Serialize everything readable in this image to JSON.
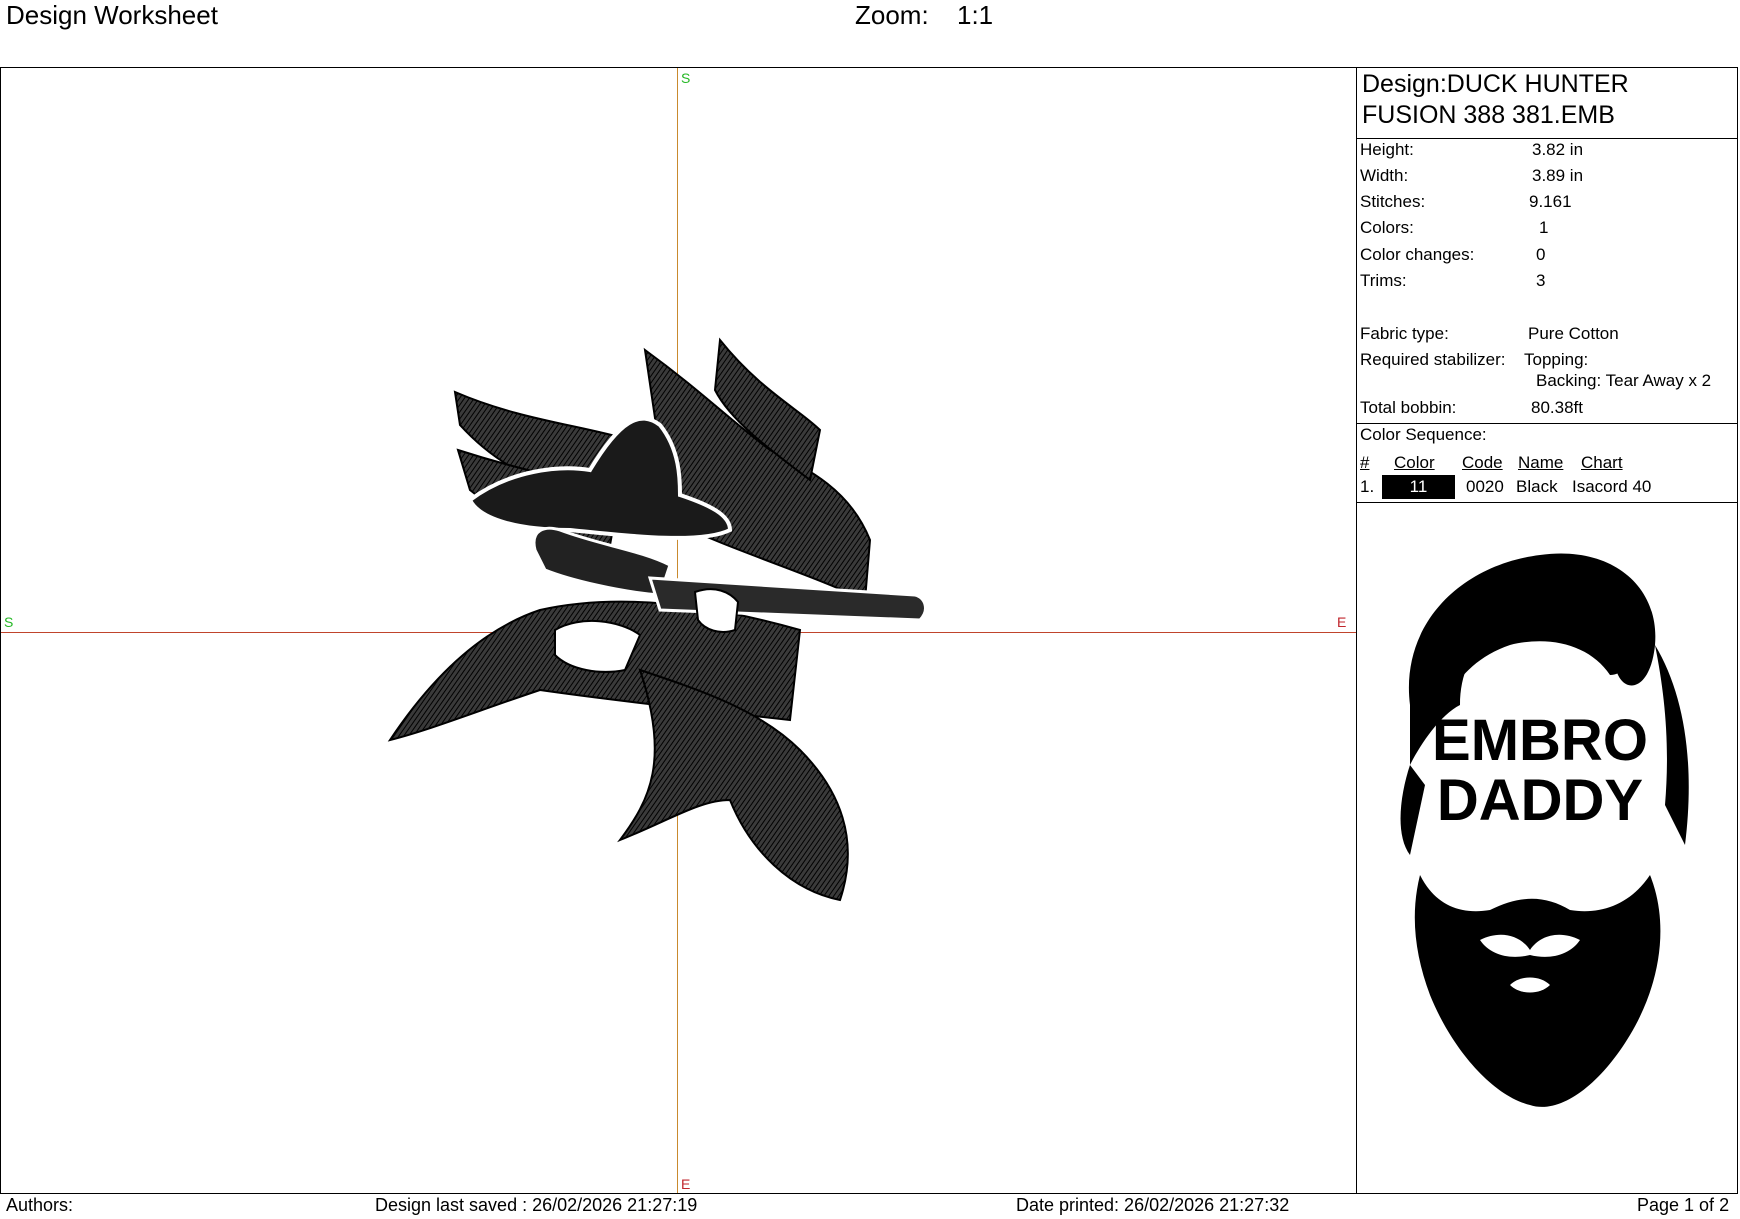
{
  "header": {
    "title": "Design Worksheet",
    "zoom_label": "Zoom:",
    "zoom_value": "1:1"
  },
  "axes": {
    "top": "S",
    "left": "S",
    "right": "E",
    "bottom": "E"
  },
  "colors": {
    "vertical_axis": "#c98a2e",
    "horizontal_axis": "#c0442c",
    "label_green": "#25b825",
    "label_red": "#c0262c",
    "thread": "#000000"
  },
  "panel": {
    "design_line1": "Design:DUCK HUNTER",
    "design_line2": "FUSION 388 381.EMB",
    "stats": [
      {
        "label": "Height:",
        "value": "3.82 in"
      },
      {
        "label": "Width:",
        "value": "3.89 in"
      },
      {
        "label": "Stitches:",
        "value": "9.161"
      },
      {
        "label": "Colors:",
        "value": "1"
      },
      {
        "label": "Color changes:",
        "value": "0"
      },
      {
        "label": "Trims:",
        "value": "3"
      }
    ],
    "fabric_label": "Fabric type:",
    "fabric_value": "Pure Cotton",
    "stabilizer_label": "Required stabilizer:",
    "stabilizer_topping": "Topping:",
    "stabilizer_backing": "Backing: Tear Away x 2",
    "bobbin_label": "Total bobbin:",
    "bobbin_value": "80.38ft",
    "sequence_title": "Color Sequence:",
    "sequence_headers": [
      "#",
      "Color",
      "Code",
      "Name",
      "Chart"
    ],
    "sequence_rows": [
      {
        "index": "1.",
        "swatch": "11",
        "code": "0020",
        "name": "Black",
        "chart": "Isacord 40"
      }
    ],
    "logo_line1": "EMBRO",
    "logo_line2": "DADDY"
  },
  "footer": {
    "authors": "Authors:",
    "saved": "Design last saved : 26/02/2026 21:27:19",
    "printed": "Date printed: 26/02/2026 21:27:32",
    "page": "Page 1 of 2"
  }
}
